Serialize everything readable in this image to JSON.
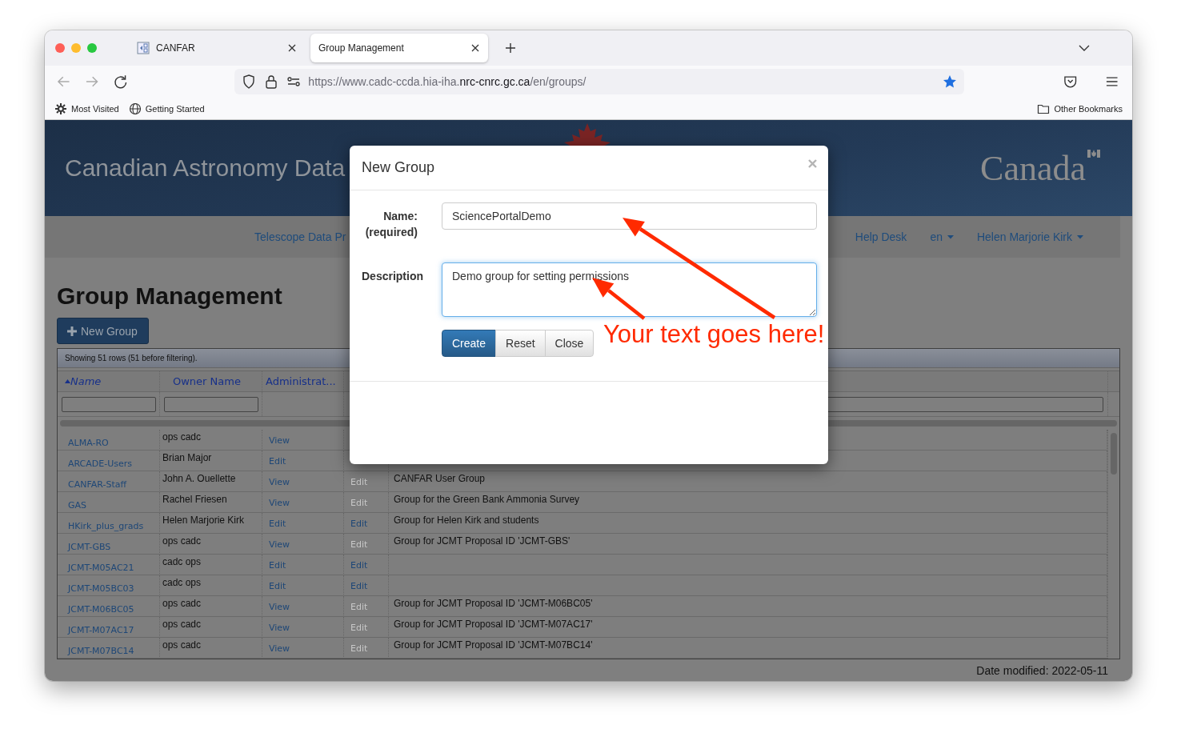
{
  "browser": {
    "tabs": [
      {
        "label": "CANFAR",
        "selected": false,
        "has_icon": true
      },
      {
        "label": "Group Management",
        "selected": true,
        "has_icon": false
      }
    ],
    "url": {
      "prefix": "https://www.cadc-ccda.hia-iha.",
      "domain": "nrc-cnrc.gc.ca",
      "path": "/en/groups/"
    },
    "bookmarked": true,
    "bookmarks": [
      {
        "label": "Most Visited",
        "kind": "gear"
      },
      {
        "label": "Getting Started",
        "kind": "globe"
      }
    ],
    "other_bookmarks": "Other Bookmarks"
  },
  "site": {
    "title": "Canadian Astronomy Data",
    "wordmark": "Canada",
    "nav": [
      {
        "label": "Telescope Data Pr",
        "dropdown": false
      },
      {
        "label": "Help Desk",
        "dropdown": false
      },
      {
        "label": "en",
        "dropdown": true
      },
      {
        "label": "Helen Marjorie Kirk",
        "dropdown": true
      }
    ]
  },
  "page": {
    "heading": "Group Management",
    "new_button": "New Group",
    "table": {
      "info": "Showing 51 rows (51 before filtering).",
      "columns": [
        {
          "label": "Name",
          "sorted": true
        },
        {
          "label": "Owner Name",
          "sorted": false
        },
        {
          "label": "Administrat...",
          "sorted": false
        }
      ],
      "rows": [
        {
          "name": "ALMA-RO",
          "owner": "ops cadc",
          "admin": "View"
        },
        {
          "name": "ARCADE-Users",
          "owner": "Brian Major",
          "admin": "Edit"
        },
        {
          "name": "CANFAR-Staff",
          "owner": "John A. Ouellette",
          "admin": "View",
          "member": {
            "label": "Edit",
            "disabled": true
          },
          "description": "CANFAR User Group"
        },
        {
          "name": "GAS",
          "owner": "Rachel Friesen",
          "admin": "View",
          "member": {
            "label": "Edit",
            "disabled": true
          },
          "description": "Group for the Green Bank Ammonia Survey"
        },
        {
          "name": "HKirk_plus_grads",
          "owner": "Helen Marjorie Kirk",
          "admin": "Edit",
          "member": {
            "label": "Edit",
            "disabled": false
          },
          "description": "Group for Helen Kirk and students"
        },
        {
          "name": "JCMT-GBS",
          "owner": "ops cadc",
          "admin": "View",
          "member": {
            "label": "Edit",
            "disabled": true
          },
          "description": "Group for JCMT Proposal ID 'JCMT-GBS'"
        },
        {
          "name": "JCMT-M05AC21",
          "owner": "cadc ops",
          "admin": "Edit",
          "member": {
            "label": "Edit",
            "disabled": false
          }
        },
        {
          "name": "JCMT-M05BC03",
          "owner": "cadc ops",
          "admin": "Edit",
          "member": {
            "label": "Edit",
            "disabled": false
          }
        },
        {
          "name": "JCMT-M06BC05",
          "owner": "ops cadc",
          "admin": "View",
          "member": {
            "label": "Edit",
            "disabled": true
          },
          "description": "Group for JCMT Proposal ID 'JCMT-M06BC05'"
        },
        {
          "name": "JCMT-M07AC17",
          "owner": "ops cadc",
          "admin": "View",
          "member": {
            "label": "Edit",
            "disabled": true
          },
          "description": "Group for JCMT Proposal ID 'JCMT-M07AC17'"
        },
        {
          "name": "JCMT-M07BC14",
          "owner": "ops cadc",
          "admin": "View",
          "member": {
            "label": "Edit",
            "disabled": true
          },
          "description": "Group for JCMT Proposal ID 'JCMT-M07BC14'"
        }
      ]
    },
    "date_modified": "Date modified: 2022-05-11"
  },
  "dialog": {
    "title": "New Group",
    "fields": [
      {
        "kind": "input",
        "label": "Name:",
        "sublabel": "(required)",
        "value": "SciencePortalDemo",
        "focused": false
      },
      {
        "kind": "textarea",
        "label": "Description",
        "value": "Demo group for setting permissions",
        "focused": true
      }
    ],
    "buttons": [
      {
        "label": "Create",
        "primary": true
      },
      {
        "label": "Reset",
        "primary": false
      },
      {
        "label": "Close",
        "primary": false
      }
    ]
  },
  "annotation": {
    "text": "Your text goes here!"
  }
}
